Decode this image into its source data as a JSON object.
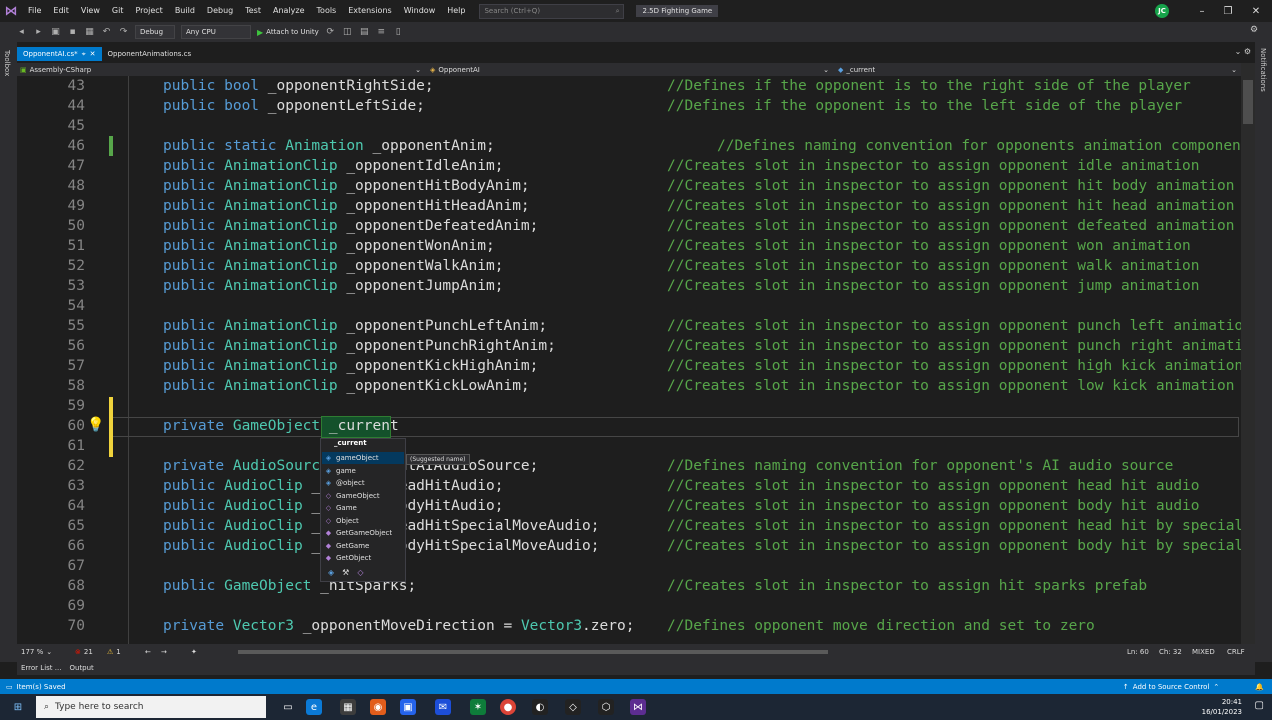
{
  "menu": [
    "File",
    "Edit",
    "View",
    "Git",
    "Project",
    "Build",
    "Debug",
    "Test",
    "Analyze",
    "Tools",
    "Extensions",
    "Window",
    "Help"
  ],
  "search": {
    "placeholder": "Search (Ctrl+Q)"
  },
  "solution_name": "2.5D Fighting Game",
  "user_initials": "JC",
  "toolbar": {
    "config": "Debug",
    "platform": "Any CPU",
    "run_label": "Attach to Unity"
  },
  "side": {
    "toolbox": "Toolbox",
    "notifications": "Notifications"
  },
  "tabs": [
    {
      "label": "OpponentAI.cs*",
      "active": true
    },
    {
      "label": "OpponentAnimations.cs",
      "active": false
    }
  ],
  "nav": {
    "project": "Assembly-CSharp",
    "class": "OpponentAI",
    "member": "_current"
  },
  "code_lines": [
    {
      "n": "43",
      "parts": [
        [
          "kw",
          "public "
        ],
        [
          "kw",
          "bool "
        ],
        [
          "pl",
          "_opponentRightSide;"
        ]
      ],
      "comment": "//Defines if the opponent is to the right side of the player"
    },
    {
      "n": "44",
      "parts": [
        [
          "kw",
          "public "
        ],
        [
          "kw",
          "bool "
        ],
        [
          "pl",
          "_opponentLeftSide;"
        ]
      ],
      "comment": "//Defines if the opponent is to the left side of the player"
    },
    {
      "n": "45",
      "parts": [],
      "comment": ""
    },
    {
      "n": "46",
      "parts": [
        [
          "kw",
          "public "
        ],
        [
          "kw",
          "static "
        ],
        [
          "ty",
          "Animation "
        ],
        [
          "pl",
          "_opponentAnim;"
        ]
      ],
      "comment": "//Defines naming convention for opponents animation component"
    },
    {
      "n": "47",
      "parts": [
        [
          "kw",
          "public "
        ],
        [
          "ty",
          "AnimationClip "
        ],
        [
          "pl",
          "_opponentIdleAnim;"
        ]
      ],
      "comment": "//Creates slot in inspector to assign opponent idle animation"
    },
    {
      "n": "48",
      "parts": [
        [
          "kw",
          "public "
        ],
        [
          "ty",
          "AnimationClip "
        ],
        [
          "pl",
          "_opponentHitBodyAnim;"
        ]
      ],
      "comment": "//Creates slot in inspector to assign opponent hit body animation"
    },
    {
      "n": "49",
      "parts": [
        [
          "kw",
          "public "
        ],
        [
          "ty",
          "AnimationClip "
        ],
        [
          "pl",
          "_opponentHitHeadAnim;"
        ]
      ],
      "comment": "//Creates slot in inspector to assign opponent hit head animation"
    },
    {
      "n": "50",
      "parts": [
        [
          "kw",
          "public "
        ],
        [
          "ty",
          "AnimationClip "
        ],
        [
          "pl",
          "_opponentDefeatedAnim;"
        ]
      ],
      "comment": "//Creates slot in inspector to assign opponent defeated animation"
    },
    {
      "n": "51",
      "parts": [
        [
          "kw",
          "public "
        ],
        [
          "ty",
          "AnimationClip "
        ],
        [
          "pl",
          "_opponentWonAnim;"
        ]
      ],
      "comment": "//Creates slot in inspector to assign opponent won animation"
    },
    {
      "n": "52",
      "parts": [
        [
          "kw",
          "public "
        ],
        [
          "ty",
          "AnimationClip "
        ],
        [
          "pl",
          "_opponentWalkAnim;"
        ]
      ],
      "comment": "//Creates slot in inspector to assign opponent walk animation"
    },
    {
      "n": "53",
      "parts": [
        [
          "kw",
          "public "
        ],
        [
          "ty",
          "AnimationClip "
        ],
        [
          "pl",
          "_opponentJumpAnim;"
        ]
      ],
      "comment": "//Creates slot in inspector to assign opponent jump animation"
    },
    {
      "n": "54",
      "parts": [],
      "comment": ""
    },
    {
      "n": "55",
      "parts": [
        [
          "kw",
          "public "
        ],
        [
          "ty",
          "AnimationClip "
        ],
        [
          "pl",
          "_opponentPunchLeftAnim;"
        ]
      ],
      "comment": "//Creates slot in inspector to assign opponent punch left animation"
    },
    {
      "n": "56",
      "parts": [
        [
          "kw",
          "public "
        ],
        [
          "ty",
          "AnimationClip "
        ],
        [
          "pl",
          "_opponentPunchRightAnim;"
        ]
      ],
      "comment": "//Creates slot in inspector to assign opponent punch right animation"
    },
    {
      "n": "57",
      "parts": [
        [
          "kw",
          "public "
        ],
        [
          "ty",
          "AnimationClip "
        ],
        [
          "pl",
          "_opponentKickHighAnim;"
        ]
      ],
      "comment": "//Creates slot in inspector to assign opponent high kick animation"
    },
    {
      "n": "58",
      "parts": [
        [
          "kw",
          "public "
        ],
        [
          "ty",
          "AnimationClip "
        ],
        [
          "pl",
          "_opponentKickLowAnim;"
        ]
      ],
      "comment": "//Creates slot in inspector to assign opponent low kick animation"
    },
    {
      "n": "59",
      "parts": [],
      "comment": ""
    },
    {
      "n": "60",
      "parts": [
        [
          "kw",
          "private "
        ],
        [
          "ty",
          "GameObject "
        ],
        [
          "pl",
          "_current"
        ]
      ],
      "comment": ""
    },
    {
      "n": "61",
      "parts": [],
      "comment": ""
    },
    {
      "n": "62",
      "parts": [
        [
          "kw",
          "private "
        ],
        [
          "ty",
          "AudioSource "
        ],
        [
          "pl",
          "_opponentAIAudioSource;"
        ]
      ],
      "comment": "//Defines naming convention for opponent's AI audio source"
    },
    {
      "n": "63",
      "parts": [
        [
          "kw",
          "public "
        ],
        [
          "ty",
          "AudioClip "
        ],
        [
          "pl",
          "_opponentHeadHitAudio;"
        ]
      ],
      "comment": "//Creates slot in inspector to assign opponent head hit audio"
    },
    {
      "n": "64",
      "parts": [
        [
          "kw",
          "public "
        ],
        [
          "ty",
          "AudioClip "
        ],
        [
          "pl",
          "_opponentBodyHitAudio;"
        ]
      ],
      "comment": "//Creates slot in inspector to assign opponent body hit audio"
    },
    {
      "n": "65",
      "parts": [
        [
          "kw",
          "public "
        ],
        [
          "ty",
          "AudioClip "
        ],
        [
          "pl",
          "_opponentHeadHitSpecialMoveAudio;"
        ]
      ],
      "comment": "//Creates slot in inspector to assign opponent head hit by special mo"
    },
    {
      "n": "66",
      "parts": [
        [
          "kw",
          "public "
        ],
        [
          "ty",
          "AudioClip "
        ],
        [
          "pl",
          "_opponentBodyHitSpecialMoveAudio;"
        ]
      ],
      "comment": "//Creates slot in inspector to assign opponent body hit by special mo"
    },
    {
      "n": "67",
      "parts": [],
      "comment": ""
    },
    {
      "n": "68",
      "parts": [
        [
          "kw",
          "public "
        ],
        [
          "ty",
          "GameObject "
        ],
        [
          "pl",
          "_hitSparks;"
        ]
      ],
      "comment": "//Creates slot in inspector to assign hit sparks prefab"
    },
    {
      "n": "69",
      "parts": [],
      "comment": ""
    },
    {
      "n": "70",
      "parts": [
        [
          "kw",
          "private "
        ],
        [
          "ty",
          "Vector3 "
        ],
        [
          "pl",
          "_opponentMoveDirection = "
        ],
        [
          "ty",
          "Vector3"
        ],
        [
          "pl",
          ".zero;"
        ]
      ],
      "comment": "//Defines opponent move direction and set to zero"
    }
  ],
  "completion": {
    "header": "_current",
    "suggested_tag": "(Suggested name)",
    "items": [
      "gameObject",
      "game",
      "@object",
      "GameObject",
      "Game",
      "Object",
      "GetGameObject",
      "GetGame",
      "GetObject"
    ]
  },
  "editor_status": {
    "zoom": "177 %",
    "errors": "21",
    "warnings": "1",
    "line": "Ln: 60",
    "col": "Ch: 32",
    "whitespace": "MIXED",
    "eol": "CRLF"
  },
  "panel_tabs": [
    "Error List ...",
    "Output"
  ],
  "status": {
    "left": "Item(s) Saved",
    "right": "Add to Source Control"
  },
  "taskbar": {
    "search_placeholder": "Type here to search",
    "time": "20:41",
    "date": "16/01/2023"
  }
}
